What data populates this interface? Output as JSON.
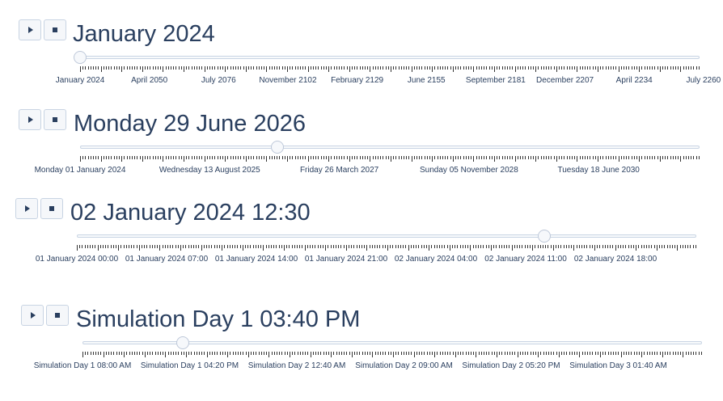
{
  "sliders": [
    {
      "title": "January 2024",
      "play_icon": "play-icon",
      "stop_icon": "stop-icon",
      "value_fraction": 0.0,
      "tick_labels": [
        "January 2024",
        "April 2050",
        "July 2076",
        "November 2102",
        "February 2129",
        "June 2155",
        "September 2181",
        "December 2207",
        "April 2234",
        "July 2260"
      ]
    },
    {
      "title": "Monday 29 June 2026",
      "play_icon": "play-icon",
      "stop_icon": "stop-icon",
      "value_fraction": 0.318,
      "tick_labels": [
        "Monday 01 January 2024",
        "Wednesday 13 August 2025",
        "Friday 26 March 2027",
        "Sunday 05 November 2028",
        "Tuesday 18 June 2030"
      ]
    },
    {
      "title": "02 January 2024 12:30",
      "play_icon": "play-icon",
      "stop_icon": "stop-icon",
      "value_fraction": 0.755,
      "tick_labels": [
        "01 January 2024 00:00",
        "01 January 2024 07:00",
        "01 January 2024 14:00",
        "01 January 2024 21:00",
        "02 January 2024 04:00",
        "02 January 2024 11:00",
        "02 January 2024 18:00"
      ]
    },
    {
      "title": "Simulation Day 1 03:40 PM",
      "play_icon": "play-icon",
      "stop_icon": "stop-icon",
      "value_fraction": 0.162,
      "tick_labels": [
        "Simulation Day 1 08:00 AM",
        "Simulation Day 1 04:20 PM",
        "Simulation Day 2 12:40 AM",
        "Simulation Day 2 09:00 AM",
        "Simulation Day 2 05:20 PM",
        "Simulation Day 3 01:40 AM"
      ]
    }
  ]
}
